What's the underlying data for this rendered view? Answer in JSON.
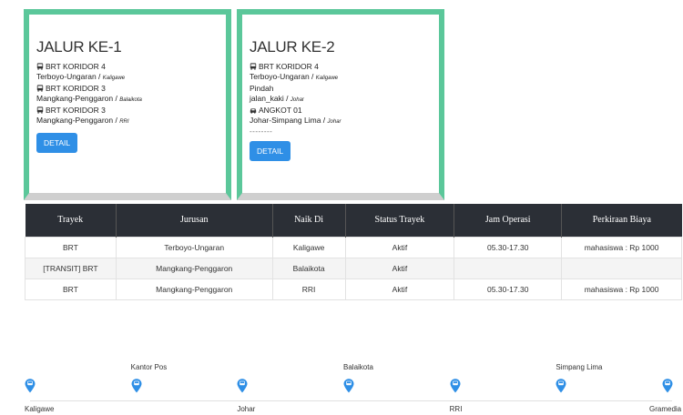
{
  "cards": [
    {
      "title": "JALUR KE-1",
      "lines": [
        {
          "icon": "bus-icon",
          "text": "BRT KORIDOR 4",
          "note": ""
        },
        {
          "icon": "",
          "text": "Terboyo-Ungaran / ",
          "note": "Kaligawe"
        },
        {
          "icon": "bus-icon",
          "text": "BRT KORIDOR 3",
          "note": ""
        },
        {
          "icon": "",
          "text": "Mangkang-Penggaron / ",
          "note": "Balaikota"
        },
        {
          "icon": "bus-icon",
          "text": "BRT KORIDOR 3",
          "note": ""
        },
        {
          "icon": "",
          "text": "Mangkang-Penggaron / ",
          "note": "RRI"
        }
      ],
      "dashes": "",
      "button": "DETAIL"
    },
    {
      "title": "JALUR KE-2",
      "lines": [
        {
          "icon": "bus-icon",
          "text": "BRT KORIDOR 4",
          "note": ""
        },
        {
          "icon": "",
          "text": "Terboyo-Ungaran / ",
          "note": "Kaligawe"
        },
        {
          "icon": "",
          "text": " Pindah",
          "note": ""
        },
        {
          "icon": "",
          "text": "jalan_kaki / ",
          "note": "Johar"
        },
        {
          "icon": "car-icon",
          "text": "ANGKOT 01",
          "note": ""
        },
        {
          "icon": "",
          "text": "Johar-Simpang Lima / ",
          "note": "Johar"
        }
      ],
      "dashes": "--------",
      "button": "DETAIL"
    }
  ],
  "table": {
    "headers": [
      "Trayek",
      "Jurusan",
      "Naik Di",
      "Status Trayek",
      "Jam Operasi",
      "Perkiraan Biaya"
    ],
    "rows": [
      [
        "BRT",
        "Terboyo-Ungaran",
        "Kaligawe",
        "Aktif",
        "05.30-17.30",
        "mahasiswa : Rp 1000"
      ],
      [
        "[TRANSIT] BRT",
        "Mangkang-Penggaron",
        "Balaikota",
        "Aktif",
        "",
        ""
      ],
      [
        "BRT",
        "Mangkang-Penggaron",
        "RRI",
        "Aktif",
        "05.30-17.30",
        "mahasiswa : Rp 1000"
      ]
    ]
  },
  "timeline": {
    "accent": "#2f8fe6",
    "stops": [
      {
        "label": "Kaligawe",
        "position": "below"
      },
      {
        "label": "Kantor Pos",
        "position": "above"
      },
      {
        "label": "Johar",
        "position": "below"
      },
      {
        "label": "Balaikota",
        "position": "above"
      },
      {
        "label": "RRI",
        "position": "below"
      },
      {
        "label": "Simpang Lima",
        "position": "above"
      },
      {
        "label": "Gramedia",
        "position": "below"
      }
    ]
  },
  "colors": {
    "card_border": "#5bc79a",
    "button": "#2f8fe6",
    "table_header": "#2b2f36"
  }
}
